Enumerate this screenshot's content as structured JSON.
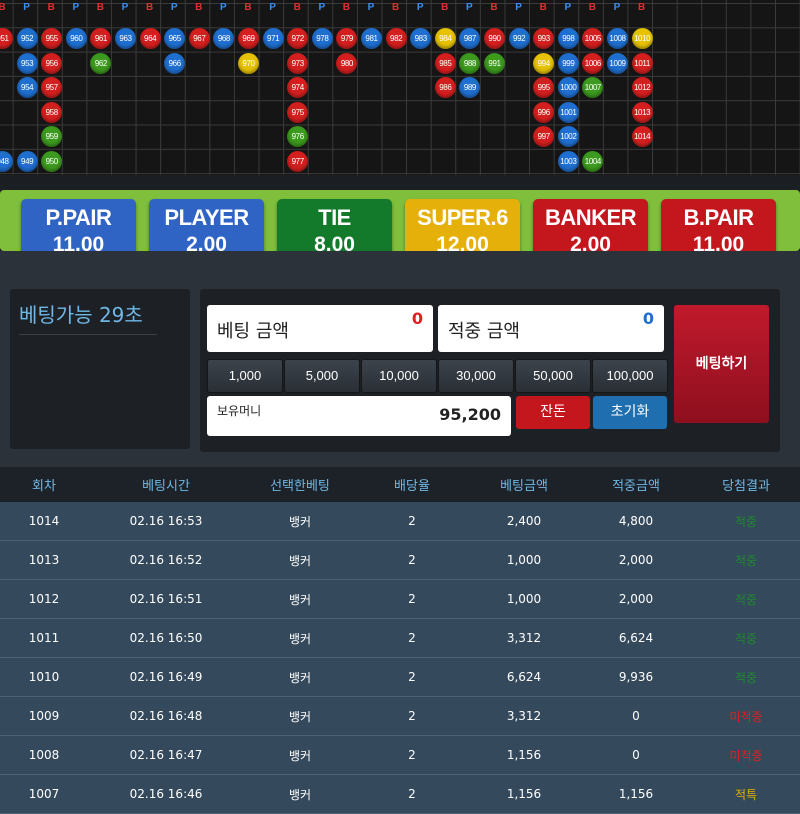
{
  "road": {
    "headers": [
      "B",
      "P",
      "B",
      "P",
      "B",
      "P",
      "B",
      "P",
      "B",
      "P",
      "B",
      "P",
      "B",
      "P",
      "B",
      "P",
      "B",
      "P",
      "B",
      "P",
      "B",
      "P",
      "B",
      "P",
      "B",
      "P",
      "B"
    ],
    "balls": [
      {
        "n": "951",
        "t": "B",
        "c": 0,
        "r": 0
      },
      {
        "n": "952",
        "t": "P",
        "c": 1,
        "r": 0
      },
      {
        "n": "955",
        "t": "B",
        "c": 2,
        "r": 0
      },
      {
        "n": "960",
        "t": "P",
        "c": 3,
        "r": 0
      },
      {
        "n": "961",
        "t": "B",
        "c": 4,
        "r": 0
      },
      {
        "n": "963",
        "t": "P",
        "c": 5,
        "r": 0
      },
      {
        "n": "964",
        "t": "B",
        "c": 6,
        "r": 0
      },
      {
        "n": "965",
        "t": "P",
        "c": 7,
        "r": 0
      },
      {
        "n": "967",
        "t": "B",
        "c": 8,
        "r": 0
      },
      {
        "n": "968",
        "t": "P",
        "c": 9,
        "r": 0
      },
      {
        "n": "969",
        "t": "B",
        "c": 10,
        "r": 0
      },
      {
        "n": "971",
        "t": "P",
        "c": 11,
        "r": 0
      },
      {
        "n": "972",
        "t": "B",
        "c": 12,
        "r": 0
      },
      {
        "n": "978",
        "t": "P",
        "c": 13,
        "r": 0
      },
      {
        "n": "979",
        "t": "B",
        "c": 14,
        "r": 0
      },
      {
        "n": "981",
        "t": "P",
        "c": 15,
        "r": 0
      },
      {
        "n": "982",
        "t": "B",
        "c": 16,
        "r": 0
      },
      {
        "n": "983",
        "t": "P",
        "c": 17,
        "r": 0
      },
      {
        "n": "984",
        "t": "S",
        "c": 18,
        "r": 0
      },
      {
        "n": "987",
        "t": "P",
        "c": 19,
        "r": 0
      },
      {
        "n": "990",
        "t": "B",
        "c": 20,
        "r": 0
      },
      {
        "n": "992",
        "t": "P",
        "c": 21,
        "r": 0
      },
      {
        "n": "993",
        "t": "B",
        "c": 22,
        "r": 0
      },
      {
        "n": "998",
        "t": "P",
        "c": 23,
        "r": 0
      },
      {
        "n": "1005",
        "t": "B",
        "c": 24,
        "r": 0
      },
      {
        "n": "1008",
        "t": "P",
        "c": 25,
        "r": 0
      },
      {
        "n": "1010",
        "t": "S",
        "c": 26,
        "r": 0
      },
      {
        "n": "953",
        "t": "P",
        "c": 1,
        "r": 1
      },
      {
        "n": "956",
        "t": "B",
        "c": 2,
        "r": 1
      },
      {
        "n": "962",
        "t": "T",
        "c": 4,
        "r": 1
      },
      {
        "n": "966",
        "t": "P",
        "c": 7,
        "r": 1
      },
      {
        "n": "970",
        "t": "S",
        "c": 10,
        "r": 1
      },
      {
        "n": "973",
        "t": "B",
        "c": 12,
        "r": 1
      },
      {
        "n": "980",
        "t": "B",
        "c": 14,
        "r": 1
      },
      {
        "n": "985",
        "t": "B",
        "c": 18,
        "r": 1
      },
      {
        "n": "988",
        "t": "T",
        "c": 19,
        "r": 1
      },
      {
        "n": "991",
        "t": "T",
        "c": 20,
        "r": 1
      },
      {
        "n": "994",
        "t": "S",
        "c": 22,
        "r": 1
      },
      {
        "n": "999",
        "t": "P",
        "c": 23,
        "r": 1
      },
      {
        "n": "1006",
        "t": "B",
        "c": 24,
        "r": 1
      },
      {
        "n": "1009",
        "t": "P",
        "c": 25,
        "r": 1
      },
      {
        "n": "1011",
        "t": "B",
        "c": 26,
        "r": 1
      },
      {
        "n": "954",
        "t": "P",
        "c": 1,
        "r": 2
      },
      {
        "n": "957",
        "t": "B",
        "c": 2,
        "r": 2
      },
      {
        "n": "974",
        "t": "B",
        "c": 12,
        "r": 2
      },
      {
        "n": "986",
        "t": "B",
        "c": 18,
        "r": 2
      },
      {
        "n": "989",
        "t": "P",
        "c": 19,
        "r": 2
      },
      {
        "n": "995",
        "t": "B",
        "c": 22,
        "r": 2
      },
      {
        "n": "1000",
        "t": "P",
        "c": 23,
        "r": 2
      },
      {
        "n": "1007",
        "t": "T",
        "c": 24,
        "r": 2
      },
      {
        "n": "1012",
        "t": "B",
        "c": 26,
        "r": 2
      },
      {
        "n": "958",
        "t": "B",
        "c": 2,
        "r": 3
      },
      {
        "n": "975",
        "t": "B",
        "c": 12,
        "r": 3
      },
      {
        "n": "996",
        "t": "B",
        "c": 22,
        "r": 3
      },
      {
        "n": "1001",
        "t": "P",
        "c": 23,
        "r": 3
      },
      {
        "n": "1013",
        "t": "B",
        "c": 26,
        "r": 3
      },
      {
        "n": "959",
        "t": "T",
        "c": 2,
        "r": 4
      },
      {
        "n": "976",
        "t": "T",
        "c": 12,
        "r": 4
      },
      {
        "n": "997",
        "t": "B",
        "c": 22,
        "r": 4
      },
      {
        "n": "1002",
        "t": "P",
        "c": 23,
        "r": 4
      },
      {
        "n": "1014",
        "t": "B",
        "c": 26,
        "r": 4
      },
      {
        "n": "948",
        "t": "P",
        "c": 0,
        "r": 5
      },
      {
        "n": "949",
        "t": "P",
        "c": 1,
        "r": 5
      },
      {
        "n": "950",
        "t": "T",
        "c": 2,
        "r": 5
      },
      {
        "n": "977",
        "t": "B",
        "c": 12,
        "r": 5
      },
      {
        "n": "1003",
        "t": "P",
        "c": 23,
        "r": 5
      },
      {
        "n": "1004",
        "t": "T",
        "c": 24,
        "r": 5
      }
    ]
  },
  "bets": [
    {
      "name": "P.PAIR",
      "odds": "11.00",
      "color": "#2f63c4"
    },
    {
      "name": "PLAYER",
      "odds": "2.00",
      "color": "#2f63c4"
    },
    {
      "name": "TIE",
      "odds": "8.00",
      "color": "#137a2c"
    },
    {
      "name": "SUPER.6",
      "odds": "12.00",
      "color": "#e6b00a"
    },
    {
      "name": "BANKER",
      "odds": "2.00",
      "color": "#c4161d"
    },
    {
      "name": "B.PAIR",
      "odds": "11.00",
      "color": "#c4161d"
    }
  ],
  "timer": {
    "text": "베팅가능 29초"
  },
  "bet_amount": {
    "label": "베팅 금액",
    "value": "0",
    "color": "#e02020"
  },
  "win_amount": {
    "label": "적중 금액",
    "value": "0",
    "color": "#1f6fd0"
  },
  "chips": [
    "1,000",
    "5,000",
    "10,000",
    "30,000",
    "50,000",
    "100,000"
  ],
  "balance": {
    "label": "보유머니",
    "value": "95,200"
  },
  "buttons": {
    "remain": "잔돈",
    "reset": "초기화",
    "place": "베팅하기"
  },
  "history": {
    "headers": [
      "회차",
      "베팅시간",
      "선택한베팅",
      "배당율",
      "베팅금액",
      "적중금액",
      "당첨결과"
    ],
    "rows": [
      {
        "round": "1014",
        "time": "02.16 16:53",
        "pick": "뱅커",
        "odds": "2",
        "bet": "2,400",
        "win": "4,800",
        "result": "적중",
        "rcolor": "#1f8a2c"
      },
      {
        "round": "1013",
        "time": "02.16 16:52",
        "pick": "뱅커",
        "odds": "2",
        "bet": "1,000",
        "win": "2,000",
        "result": "적중",
        "rcolor": "#1f8a2c"
      },
      {
        "round": "1012",
        "time": "02.16 16:51",
        "pick": "뱅커",
        "odds": "2",
        "bet": "1,000",
        "win": "2,000",
        "result": "적중",
        "rcolor": "#1f8a2c"
      },
      {
        "round": "1011",
        "time": "02.16 16:50",
        "pick": "뱅커",
        "odds": "2",
        "bet": "3,312",
        "win": "6,624",
        "result": "적중",
        "rcolor": "#1f8a2c"
      },
      {
        "round": "1010",
        "time": "02.16 16:49",
        "pick": "뱅커",
        "odds": "2",
        "bet": "6,624",
        "win": "9,936",
        "result": "적중",
        "rcolor": "#1f8a2c"
      },
      {
        "round": "1009",
        "time": "02.16 16:48",
        "pick": "뱅커",
        "odds": "2",
        "bet": "3,312",
        "win": "0",
        "result": "미적중",
        "rcolor": "#e02020"
      },
      {
        "round": "1008",
        "time": "02.16 16:47",
        "pick": "뱅커",
        "odds": "2",
        "bet": "1,156",
        "win": "0",
        "result": "미적중",
        "rcolor": "#e02020"
      },
      {
        "round": "1007",
        "time": "02.16 16:46",
        "pick": "뱅커",
        "odds": "2",
        "bet": "1,156",
        "win": "1,156",
        "result": "적특",
        "rcolor": "#e6b00a"
      }
    ]
  }
}
